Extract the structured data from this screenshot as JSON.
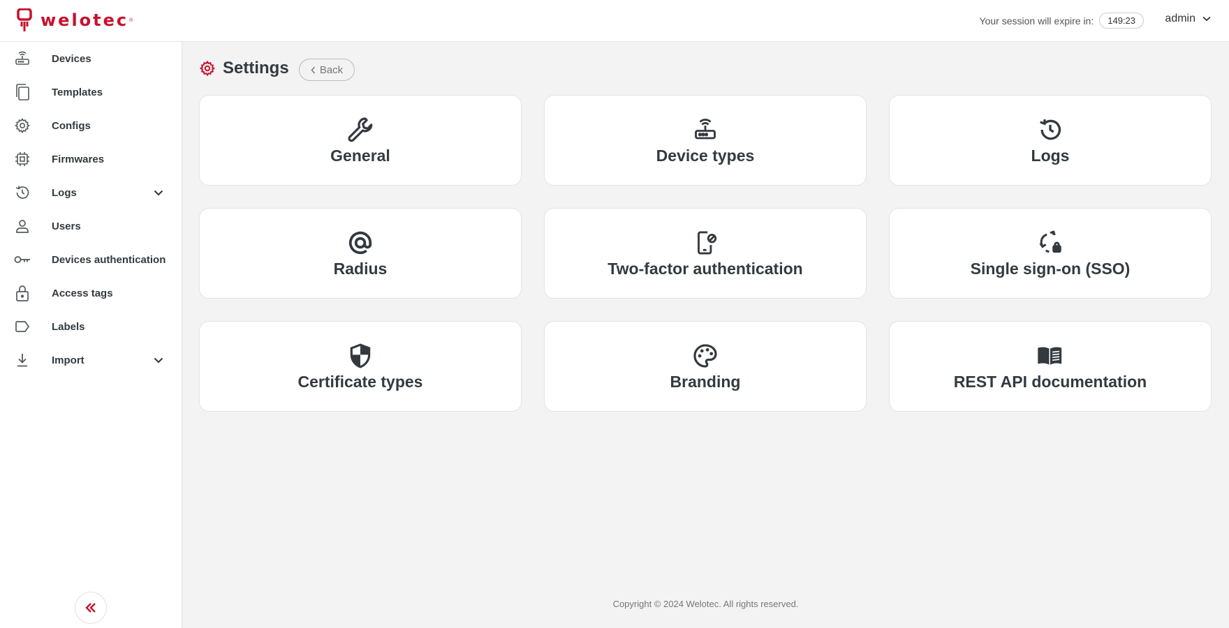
{
  "brand": {
    "name": "welotec",
    "accent": "#c8102e"
  },
  "header": {
    "session_label": "Your session will expire in:",
    "session_timer": "149:23",
    "user_name": "admin"
  },
  "sidebar": {
    "items": [
      {
        "label": "Devices",
        "icon": "router-icon"
      },
      {
        "label": "Templates",
        "icon": "copy-icon"
      },
      {
        "label": "Configs",
        "icon": "gear-icon"
      },
      {
        "label": "Firmwares",
        "icon": "chip-icon"
      },
      {
        "label": "Logs",
        "icon": "history-icon",
        "expandable": true
      },
      {
        "label": "Users",
        "icon": "user-icon"
      },
      {
        "label": "Devices authentication",
        "icon": "key-icon"
      },
      {
        "label": "Access tags",
        "icon": "lock-icon"
      },
      {
        "label": "Labels",
        "icon": "label-icon"
      },
      {
        "label": "Import",
        "icon": "download-icon",
        "expandable": true
      }
    ]
  },
  "page": {
    "title": "Settings",
    "back_label": "Back"
  },
  "cards": [
    {
      "label": "General",
      "icon": "wrench-icon"
    },
    {
      "label": "Device types",
      "icon": "router-icon"
    },
    {
      "label": "Logs",
      "icon": "history-icon"
    },
    {
      "label": "Radius",
      "icon": "at-sign-icon"
    },
    {
      "label": "Two-factor authentication",
      "icon": "phone-lock-icon"
    },
    {
      "label": "Single sign-on (SSO)",
      "icon": "sync-lock-icon"
    },
    {
      "label": "Certificate types",
      "icon": "shield-icon"
    },
    {
      "label": "Branding",
      "icon": "palette-icon"
    },
    {
      "label": "REST API documentation",
      "icon": "book-icon"
    }
  ],
  "footer": {
    "copyright": "Copyright © 2024 Welotec. All rights reserved."
  }
}
